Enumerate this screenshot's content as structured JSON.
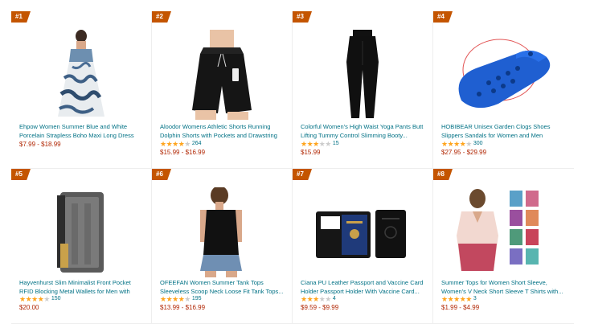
{
  "products": [
    {
      "rank": "#1",
      "title": "Ehpow Women Summer Blue and White Porcelain Strapless Boho Maxi Long Dress",
      "price": "$7.99 - $18.99",
      "reviews": "",
      "stars": 0
    },
    {
      "rank": "#2",
      "title": "Aloodor Womens Athletic Shorts Running Dolphin Shorts with Pockets and Drawstring",
      "price": "$15.99 - $16.99",
      "reviews": "264",
      "stars": 4.5
    },
    {
      "rank": "#3",
      "title": "Colorful Women's High Waist Yoga Pants Butt Lifting Tummy Control Slimming Booty...",
      "price": "$15.99",
      "reviews": "15",
      "stars": 3.5
    },
    {
      "rank": "#4",
      "title": "HOBIBEAR Unisex Garden Clogs Shoes Slippers Sandals for Women and Men",
      "price": "$27.95 - $29.99",
      "reviews": "300",
      "stars": 4.5
    },
    {
      "rank": "#5",
      "title": "Hayvenhurst Slim Minimalist Front Pocket RFID Blocking Metal Wallets for Men with Money...",
      "price": "$20.00",
      "reviews": "150",
      "stars": 4.5
    },
    {
      "rank": "#6",
      "title": "OFEEFAN Women Summer Tank Tops Sleeveless Scoop Neck Loose Fit Tank Tops...",
      "price": "$13.99 - $16.99",
      "reviews": "195",
      "stars": 4.5
    },
    {
      "rank": "#7",
      "title": "Ciana PU Leather Passport and Vaccine Card Holder Passport Holder With Vaccine Card...",
      "price": "$9.59 - $9.99",
      "reviews": "4",
      "stars": 3
    },
    {
      "rank": "#8",
      "title": "Summer Tops for Women Short Sleeve, Women's V Neck Short Sleeve T Shirts with...",
      "price": "$1.99 - $4.99",
      "reviews": "3",
      "stars": 5
    }
  ],
  "colors": {
    "badge": "#c45500",
    "link": "#007185",
    "price": "#b12704",
    "star": "#ffa41c"
  }
}
